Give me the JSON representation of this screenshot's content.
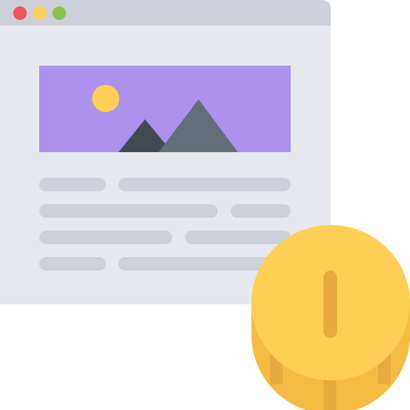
{
  "colors": {
    "background": "#ffffff",
    "window_titlebar": "#cdd0d8",
    "window_body": "#e6e8ee",
    "dot_close": "#ed5565",
    "dot_minimize": "#ffce54",
    "dot_maximize": "#8cc152",
    "image_sky": "#ac92ec",
    "sun": "#ffce54",
    "mountain_dark": "#434a54",
    "mountain_light": "#656d78",
    "text_placeholder": "#cdd0d8",
    "coin_face": "#ffce54",
    "coin_edge": "#f6bb42",
    "coin_ridge": "#e8aa3d",
    "coin_slot": "#e8aa3d"
  },
  "icons": {
    "window": "browser-window-icon",
    "image": "image-placeholder-icon",
    "coin": "coin-icon"
  }
}
